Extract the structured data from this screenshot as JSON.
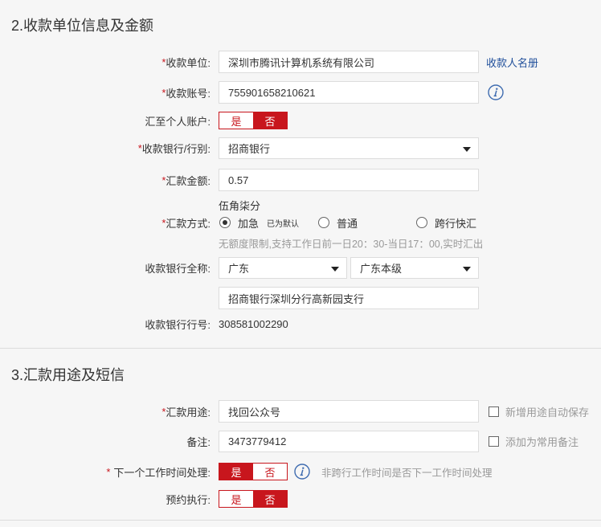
{
  "sections": {
    "payee_title": "2.收款单位信息及金额",
    "purpose_title": "3.汇款用途及短信"
  },
  "payee": {
    "required": "*",
    "label": "收款单位:",
    "value": "深圳市腾讯计算机系统有限公司",
    "link": "收款人名册"
  },
  "account": {
    "required": "*",
    "label": "收款账号:",
    "value": "755901658210621",
    "icon": "info-icon"
  },
  "personal_account": {
    "label": "汇至个人账户:",
    "yes": "是",
    "no": "否",
    "yes_active": false,
    "no_active": true
  },
  "bank": {
    "required": "*",
    "label": "收款银行/行别:",
    "value": "招商银行",
    "icon": "chevron-down-icon"
  },
  "amount": {
    "required": "*",
    "label": "汇款金额:",
    "value": "0.57",
    "in_words": "伍角柒分"
  },
  "method": {
    "required": "*",
    "label": "汇款方式:",
    "options": [
      {
        "label": "加急",
        "note": "已为默认",
        "checked": true
      },
      {
        "label": "普通",
        "checked": false
      },
      {
        "label": "跨行快汇",
        "checked": false
      }
    ],
    "hint": "无额度限制,支持工作日前一日20：30-当日17：00,实时汇出"
  },
  "bank_full_name": {
    "label": "收款银行全称:",
    "province": "广东",
    "city": "广东本级",
    "branch": "招商银行深圳分行高新园支行"
  },
  "bank_number": {
    "label": "收款银行行号:",
    "value": "308581002290"
  },
  "purpose": {
    "required": "*",
    "label": "汇款用途:",
    "value": "找回公众号",
    "save_option": "新增用途自动保存",
    "save_checked": false
  },
  "remark": {
    "label": "备注:",
    "value": "3473779412",
    "save_option": "添加为常用备注",
    "save_checked": false
  },
  "next_workday": {
    "required": "*",
    "label": "下一个工作时间处理:",
    "yes": "是",
    "no": "否",
    "yes_active": true,
    "no_active": false,
    "hint": "非跨行工作时间是否下一工作时间处理",
    "icon": "info-icon"
  },
  "scheduled": {
    "label": "预约执行:",
    "yes": "是",
    "no": "否",
    "yes_active": false,
    "no_active": true
  },
  "colors": {
    "accent": "#c8161d",
    "link": "#1f4e9a",
    "info": "#3f6cb0",
    "background": "#f6f6f6",
    "border": "#dcdcdc",
    "text": "#333333",
    "muted": "#999999"
  }
}
